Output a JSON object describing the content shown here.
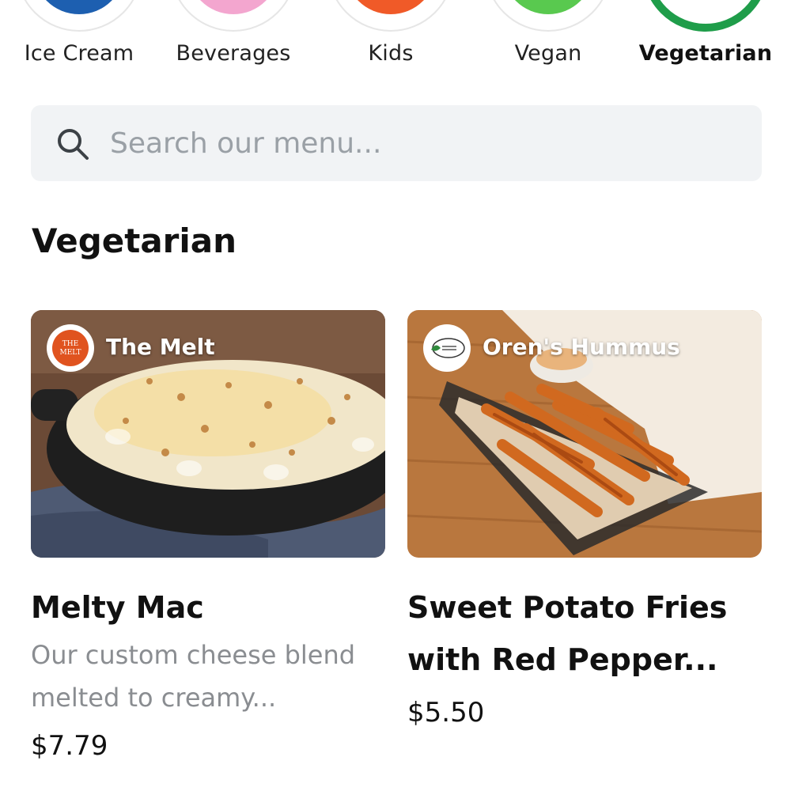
{
  "categories": [
    {
      "label": "Ice Cream",
      "color": "#1d5fb0",
      "selected": false
    },
    {
      "label": "Beverages",
      "color": "#f3a6cf",
      "selected": false
    },
    {
      "label": "Kids",
      "color": "#f05a28",
      "selected": false
    },
    {
      "label": "Vegan",
      "color": "#59c94f",
      "selected": false
    },
    {
      "label": "Vegetarian",
      "color": "#1f9d4a",
      "selected": true
    }
  ],
  "search": {
    "placeholder": "Search our menu..."
  },
  "section": {
    "title": "Vegetarian"
  },
  "items": [
    {
      "vendor": "The Melt",
      "vendor_logo_text": "THE MELT",
      "name": "Melty Mac",
      "description": "Our custom cheese blend melted to creamy...",
      "price": "$7.79"
    },
    {
      "vendor": "Oren's Hummus",
      "vendor_logo_text": "OREN'S HUMMUS",
      "name": "Sweet Potato Fries with Red Pepper...",
      "description": "",
      "price": "$5.50"
    }
  ]
}
